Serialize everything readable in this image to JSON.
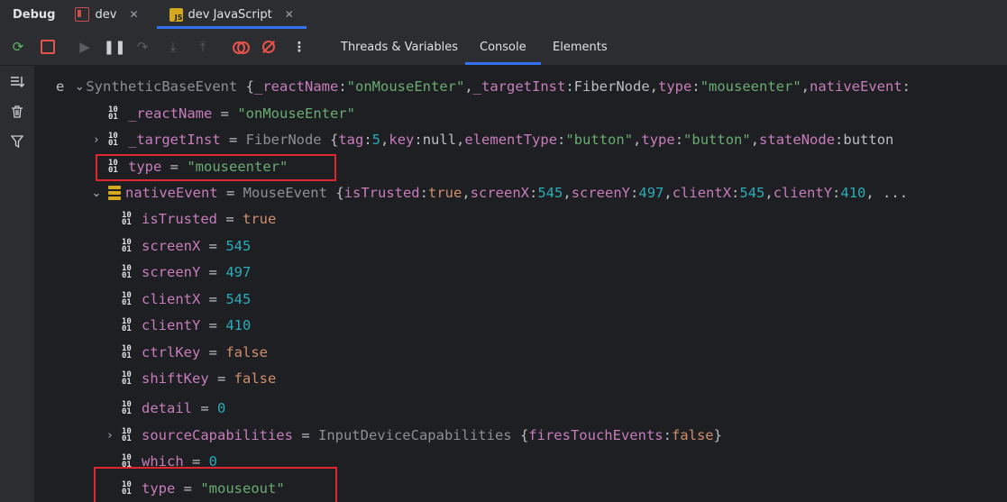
{
  "header": {
    "title": "Debug",
    "tabs": [
      {
        "label": "dev",
        "icon": "run-config-icon"
      },
      {
        "label": "dev JavaScript",
        "icon": "javascript-file-icon"
      }
    ]
  },
  "toolbar": {
    "subtabs": [
      "Threads & Variables",
      "Console",
      "Elements"
    ],
    "active_subtab": "Console"
  },
  "colors": {
    "property_name": "#c77dbb",
    "string": "#6aab73",
    "number": "#2aacb8",
    "keyword": "#cf8e6d",
    "highlight_box": "#e0262f",
    "accent": "#3574f0"
  },
  "tree": {
    "root": {
      "var": "e",
      "type": "SyntheticBaseEvent",
      "preview_open": " {",
      "preview": [
        {
          "k": "_reactName",
          "v": "\"onMouseEnter\"",
          "t": "str"
        },
        {
          "k": "_targetInst",
          "v": "FiberNode",
          "t": "plain"
        },
        {
          "k": "type",
          "v": "\"mouseenter\"",
          "t": "str"
        },
        {
          "k": "nativeEvent",
          "v": "",
          "t": "plain"
        }
      ]
    },
    "react_name": {
      "name": "_reactName",
      "value": "\"onMouseEnter\""
    },
    "target_inst": {
      "name": "_targetInst",
      "type": "FiberNode",
      "preview": [
        {
          "k": "tag",
          "v": "5",
          "t": "num"
        },
        {
          "k": "key",
          "v": "null",
          "t": "plain"
        },
        {
          "k": "elementType",
          "v": "\"button\"",
          "t": "str"
        },
        {
          "k": "type",
          "v": "\"button\"",
          "t": "str"
        },
        {
          "k": "stateNode",
          "v": "button",
          "t": "plain"
        }
      ]
    },
    "type_row": {
      "name": "type",
      "value": "\"mouseenter\""
    },
    "native_event": {
      "name": "nativeEvent",
      "type": "MouseEvent",
      "preview": [
        {
          "k": "isTrusted",
          "v": "true",
          "t": "kw"
        },
        {
          "k": "screenX",
          "v": "545",
          "t": "num"
        },
        {
          "k": "screenY",
          "v": "497",
          "t": "num"
        },
        {
          "k": "clientX",
          "v": "545",
          "t": "num"
        },
        {
          "k": "clientY",
          "v": "410",
          "t": "num"
        }
      ],
      "ellipsis": ", ..."
    },
    "children": [
      {
        "name": "isTrusted",
        "value": "true",
        "t": "kw"
      },
      {
        "name": "screenX",
        "value": "545",
        "t": "num"
      },
      {
        "name": "screenY",
        "value": "497",
        "t": "num"
      },
      {
        "name": "clientX",
        "value": "545",
        "t": "num"
      },
      {
        "name": "clientY",
        "value": "410",
        "t": "num"
      },
      {
        "name": "ctrlKey",
        "value": "false",
        "t": "kw"
      },
      {
        "name": "shiftKey",
        "value": "false",
        "t": "kw"
      },
      {
        "name": "detail",
        "value": "0",
        "t": "num"
      }
    ],
    "source_caps": {
      "name": "sourceCapabilities",
      "type": "InputDeviceCapabilities",
      "preview_key": "firesTouchEvents",
      "preview_val": "false"
    },
    "which": {
      "name": "which",
      "value": "0"
    },
    "type_out": {
      "name": "type",
      "value": "\"mouseout\""
    }
  }
}
